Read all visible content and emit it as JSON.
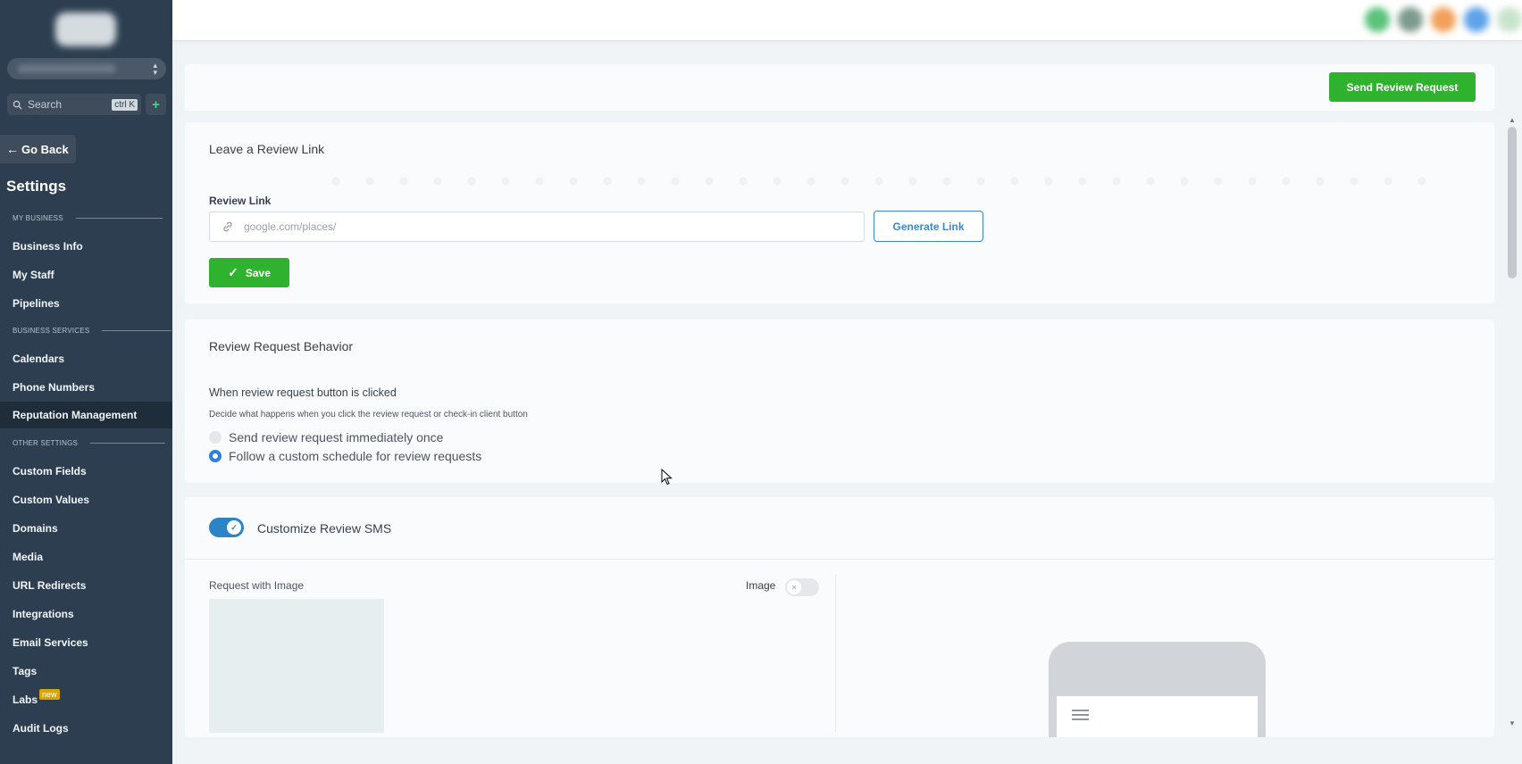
{
  "sidebar": {
    "search_placeholder": "Search",
    "search_shortcut": "ctrl K",
    "add_symbol": "+",
    "go_back": "Go Back",
    "settings_title": "Settings",
    "sections": {
      "my_business": "MY BUSINESS",
      "business_services": "BUSINESS SERVICES",
      "other_settings": "OTHER SETTINGS"
    },
    "items": {
      "business_info": "Business Info",
      "my_staff": "My Staff",
      "pipelines": "Pipelines",
      "calendars": "Calendars",
      "phone_numbers": "Phone Numbers",
      "reputation_management": "Reputation Management",
      "custom_fields": "Custom Fields",
      "custom_values": "Custom Values",
      "domains": "Domains",
      "media": "Media",
      "url_redirects": "URL Redirects",
      "integrations": "Integrations",
      "email_services": "Email Services",
      "tags": "Tags",
      "labs": "Labs",
      "labs_badge": "new",
      "audit_logs": "Audit Logs"
    }
  },
  "header": {
    "send_review_request": "Send Review Request"
  },
  "review_link_card": {
    "title": "Leave a Review Link",
    "field_label": "Review Link",
    "placeholder": "google.com/places/",
    "generate_button": "Generate Link",
    "save_button": "Save"
  },
  "behavior_card": {
    "title": "Review Request Behavior",
    "question": "When review request button is clicked",
    "description": "Decide what happens when you click the review request or check-in client button",
    "options": [
      "Send review request immediately once",
      "Follow a custom schedule for review requests"
    ],
    "selected_index": 1
  },
  "sms_card": {
    "toggle_label": "Customize Review SMS",
    "toggle_on": true,
    "request_with_image": "Request with Image",
    "image_toggle_label": "Image",
    "image_toggle_on": false
  },
  "colors": {
    "sidebar_bg": "#2c3e50",
    "primary_green": "#2fb22e",
    "accent_blue": "#2b83c8"
  }
}
